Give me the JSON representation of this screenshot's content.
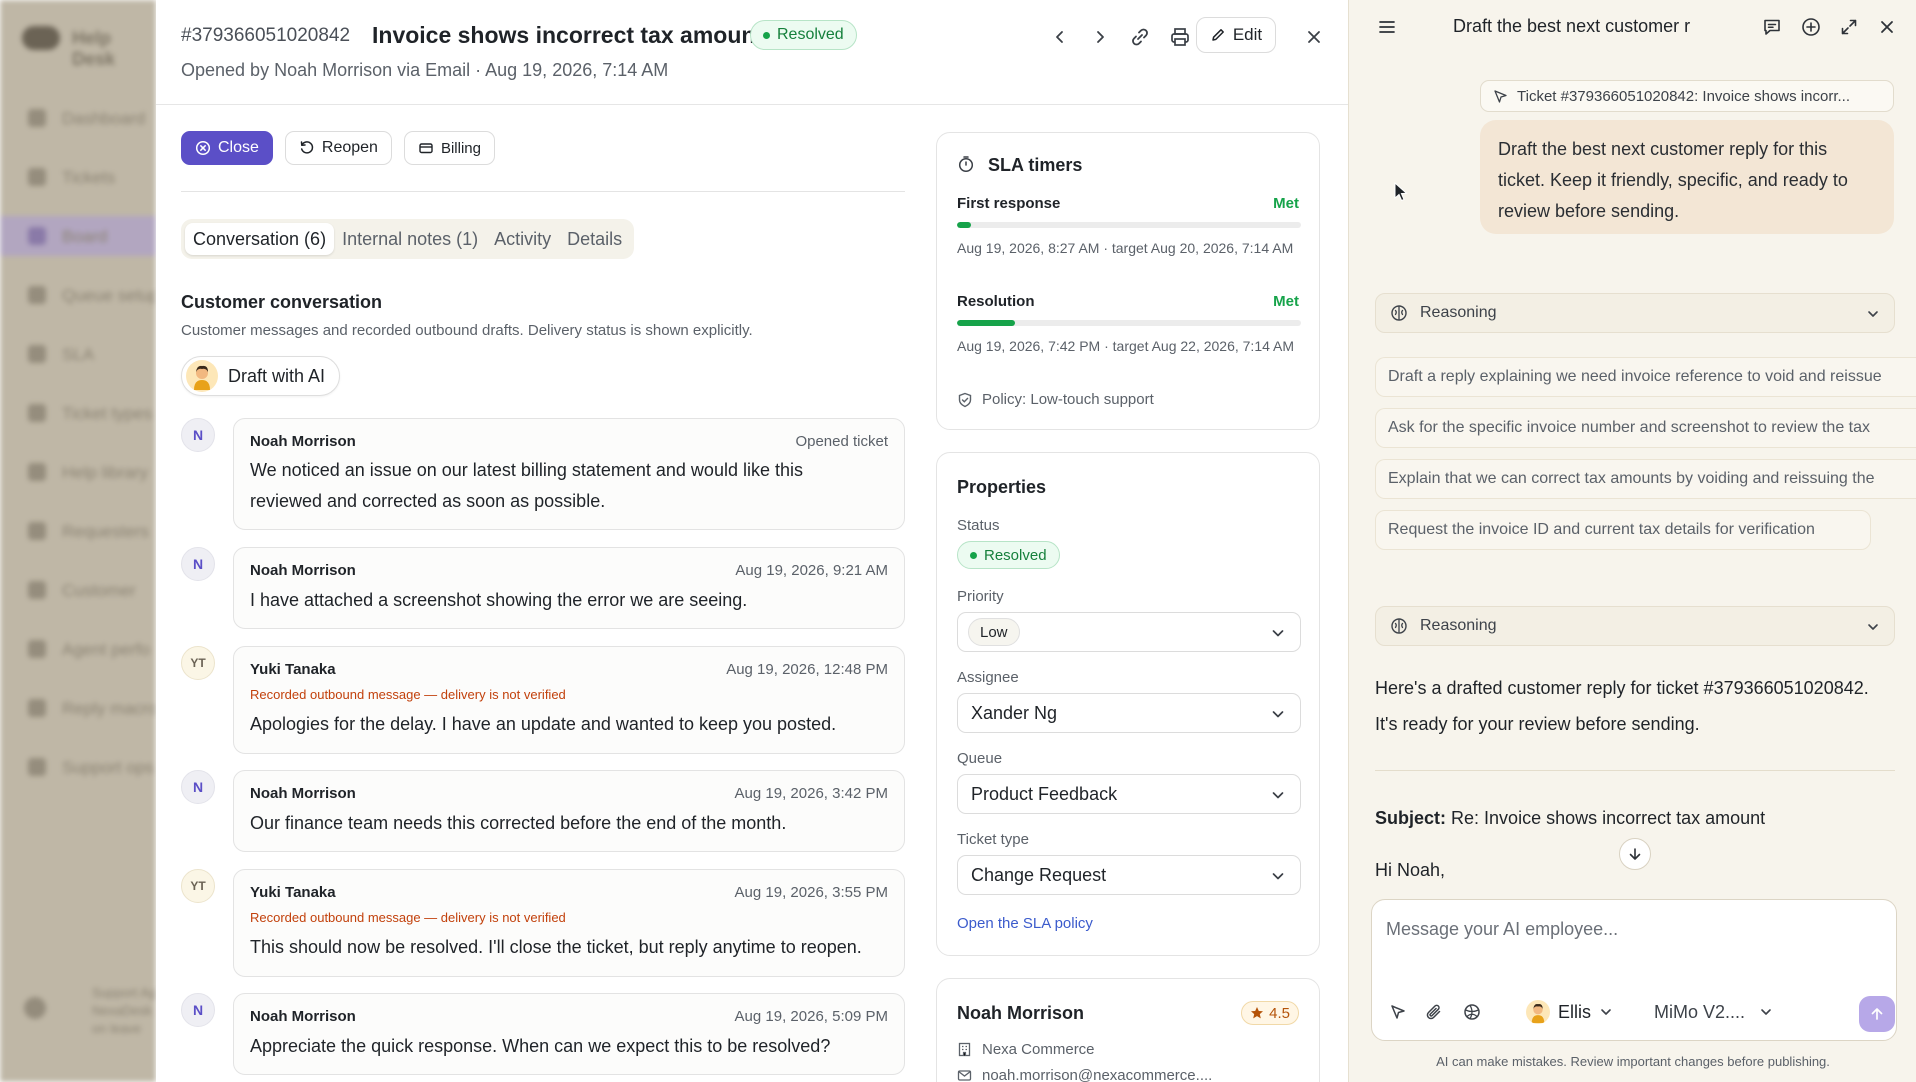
{
  "bg_sidebar": {
    "app_name": "Help Desk",
    "items": [
      "Dashboard",
      "Tickets",
      "Board",
      "Queue setup",
      "SLA",
      "Ticket types",
      "Help library",
      "Requesters",
      "Customer",
      "Agent perfo",
      "Reply macro",
      "Support ops"
    ],
    "user": {
      "name": "Support Agent",
      "line2": "NexaDesk Co.",
      "line3": "on leave"
    }
  },
  "ticket": {
    "id": "#379366051020842",
    "title": "Invoice shows incorrect tax amount",
    "status": "Resolved",
    "opened_line": "Opened by Noah Morrison via Email · Aug 19, 2026, 7:14 AM",
    "edit_label": "Edit",
    "actions": {
      "close": "Close",
      "reopen": "Reopen",
      "billing": "Billing"
    },
    "tabs": [
      "Conversation (6)",
      "Internal notes (1)",
      "Activity",
      "Details"
    ],
    "conversation_title": "Customer conversation",
    "conversation_sub": "Customer messages and recorded outbound drafts. Delivery status is shown explicitly.",
    "draft_ai_label": "Draft with AI",
    "messages": [
      {
        "avatar": "N",
        "author": "Noah Morrison",
        "time": "Opened ticket",
        "note": "",
        "text": "We noticed an issue on our latest billing statement and would like this reviewed and corrected as soon as possible."
      },
      {
        "avatar": "N",
        "author": "Noah Morrison",
        "time": "Aug 19, 2026, 9:21 AM",
        "note": "",
        "text": "I have attached a screenshot showing the error we are seeing."
      },
      {
        "avatar": "YT",
        "author": "Yuki Tanaka",
        "time": "Aug 19, 2026, 12:48 PM",
        "note": "Recorded outbound message — delivery is not verified",
        "text": "Apologies for the delay. I have an update and wanted to keep you posted."
      },
      {
        "avatar": "N",
        "author": "Noah Morrison",
        "time": "Aug 19, 2026, 3:42 PM",
        "note": "",
        "text": "Our finance team needs this corrected before the end of the month."
      },
      {
        "avatar": "YT",
        "author": "Yuki Tanaka",
        "time": "Aug 19, 2026, 3:55 PM",
        "note": "Recorded outbound message — delivery is not verified",
        "text": "This should now be resolved. I'll close the ticket, but reply anytime to reopen."
      },
      {
        "avatar": "N",
        "author": "Noah Morrison",
        "time": "Aug 19, 2026, 5:09 PM",
        "note": "",
        "text": "Appreciate the quick response. When can we expect this to be resolved?"
      }
    ]
  },
  "sla": {
    "title": "SLA timers",
    "first_response": {
      "label": "First response",
      "status": "Met",
      "progress": 0.04,
      "detail": "Aug 19, 2026, 8:27 AM · target Aug 20, 2026, 7:14 AM"
    },
    "resolution": {
      "label": "Resolution",
      "status": "Met",
      "progress": 0.17,
      "detail": "Aug 19, 2026, 7:42 PM · target Aug 22, 2026, 7:14 AM"
    },
    "policy": "Policy: Low-touch support"
  },
  "properties": {
    "title": "Properties",
    "status_label": "Status",
    "status_value": "Resolved",
    "priority_label": "Priority",
    "priority_value": "Low",
    "assignee_label": "Assignee",
    "assignee_value": "Xander Ng",
    "queue_label": "Queue",
    "queue_value": "Product Feedback",
    "type_label": "Ticket type",
    "type_value": "Change Request",
    "sla_link": "Open the SLA policy"
  },
  "contact": {
    "name": "Noah Morrison",
    "rating": "4.5",
    "company": "Nexa Commerce",
    "email": "noah.morrison@nexacommerce...."
  },
  "chat": {
    "title": "Draft the best next customer r",
    "ref_chip": "Ticket #379366051020842: Invoice shows incorr...",
    "user_message": "Draft the best next customer reply for this ticket. Keep it friendly, specific, and ready to review before sending.",
    "reasoning_label": "Reasoning",
    "suggestions": [
      "Draft a reply explaining we need invoice reference to void and reissue",
      "Ask for the specific invoice number and screenshot to review the tax",
      "Explain that we can correct tax amounts by voiding and reissuing the",
      "Request the invoice ID and current tax details for verification"
    ],
    "reply_intro": "Here's a drafted customer reply for ticket #379366051020842. It's ready for your review before sending.",
    "subject_label": "Subject:",
    "subject_value": "Re: Invoice shows incorrect tax amount",
    "salutation": "Hi Noah,",
    "composer_placeholder": "Message your AI employee...",
    "agent_name": "Ellis",
    "model_name": "MiMo V2....",
    "disclaimer": "AI can make mistakes. Review important changes before publishing."
  },
  "colors": {
    "accent": "#5b4fc7",
    "success": "#16a34a",
    "warning_text": "#c2410c",
    "chat_bg": "#f7f4ec"
  }
}
